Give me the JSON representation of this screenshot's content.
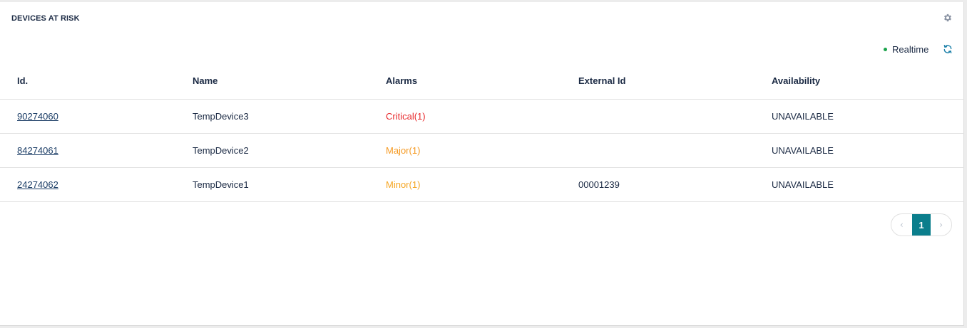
{
  "widget": {
    "title": "DEVICES AT RISK",
    "settings_icon": "gear-icon",
    "realtime_label": "Realtime",
    "realtime_status_color": "#1aa34a",
    "refresh_icon": "refresh-icon"
  },
  "table": {
    "columns": [
      "Id.",
      "Name",
      "Alarms",
      "External Id",
      "Availability"
    ],
    "rows": [
      {
        "id": "90274060",
        "name": "TempDevice3",
        "alarms": "Critical(1)",
        "alarm_color": "#e8292c",
        "external_id": "",
        "availability": "UNAVAILABLE"
      },
      {
        "id": "84274061",
        "name": "TempDevice2",
        "alarms": "Major(1)",
        "alarm_color": "#f59a23",
        "external_id": "",
        "availability": "UNAVAILABLE"
      },
      {
        "id": "24274062",
        "name": "TempDevice1",
        "alarms": "Minor(1)",
        "alarm_color": "#f5a623",
        "external_id": "00001239",
        "availability": "UNAVAILABLE"
      }
    ]
  },
  "pagination": {
    "prev_icon": "chevron-left-icon",
    "current_page": "1",
    "next_icon": "chevron-right-icon",
    "accent_color": "#0b7e8c"
  }
}
